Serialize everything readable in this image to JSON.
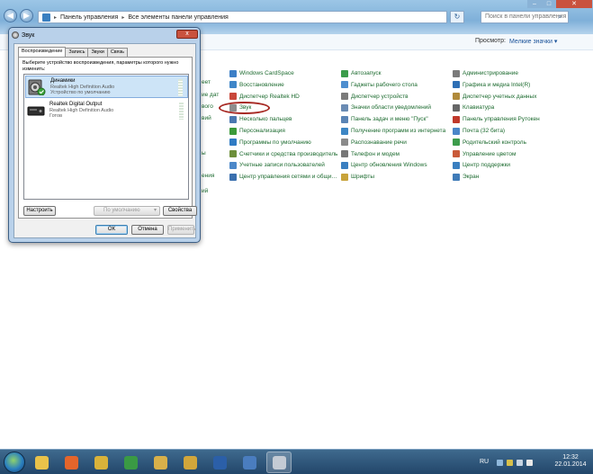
{
  "explorer": {
    "address": [
      "Панель управления",
      "Все элементы панели управления"
    ],
    "search_placeholder": "Поиск в панели управления",
    "view_label": "Просмотр:",
    "view_value": "Мелкие значки ▾"
  },
  "cp_items": {
    "col1": [
      {
        "label": "Windows CardSpace",
        "color": "#3d7fc6"
      },
      {
        "label": "Восстановление",
        "color": "#3f86c8"
      },
      {
        "label": "Диспетчер Realtek HD",
        "color": "#c9473a"
      },
      {
        "label": "Звук",
        "color": "#8d8d8d"
      },
      {
        "label": "Несколько пальцев",
        "color": "#4a78b0"
      },
      {
        "label": "Персонализация",
        "color": "#3b9a3a"
      },
      {
        "label": "Программы по умолчанию",
        "color": "#2f7bc3"
      },
      {
        "label": "Счетчики и средства производительн…",
        "color": "#6d8f3b"
      },
      {
        "label": "Учетные записи пользователей",
        "color": "#4c88c9"
      },
      {
        "label": "Центр управления сетями и общи…",
        "color": "#3a6fae"
      }
    ],
    "col2": [
      {
        "label": "Автозапуск",
        "color": "#3c9c4b"
      },
      {
        "label": "Гаджеты рабочего стола",
        "color": "#4e8ecf"
      },
      {
        "label": "Диспетчер устройств",
        "color": "#7a7a7a"
      },
      {
        "label": "Значки области уведомлений",
        "color": "#6a8bb3"
      },
      {
        "label": "Панель задач и меню \"Пуск\"",
        "color": "#5a84b5"
      },
      {
        "label": "Получение программ из интернета",
        "color": "#3d86c4"
      },
      {
        "label": "Распознавание речи",
        "color": "#8a8a8a"
      },
      {
        "label": "Телефон и модем",
        "color": "#777777"
      },
      {
        "label": "Центр обновления Windows",
        "color": "#3a7fc0"
      },
      {
        "label": "Шрифты",
        "color": "#c8a33a"
      }
    ],
    "col3": [
      {
        "label": "Администрирование",
        "color": "#7a7a7a"
      },
      {
        "label": "Графика и медиа Intel(R)",
        "color": "#2e6fb5"
      },
      {
        "label": "Диспетчер учетных данных",
        "color": "#b08a3a"
      },
      {
        "label": "Клавиатура",
        "color": "#666666"
      },
      {
        "label": "Панель управления Рутокен",
        "color": "#c0392b"
      },
      {
        "label": "Почта (32 бита)",
        "color": "#4a86c8"
      },
      {
        "label": "Родительский контроль",
        "color": "#3c9c4b"
      },
      {
        "label": "Управление цветом",
        "color": "#c95a3a"
      },
      {
        "label": "Центр поддержки",
        "color": "#3a7fc0"
      },
      {
        "label": "Экран",
        "color": "#3f7bb8"
      }
    ],
    "clipped": [
      "еет",
      "ие дат",
      "вого",
      "вий",
      "ы",
      "ения",
      "ий"
    ]
  },
  "dialog": {
    "title": "Звук",
    "close": "x",
    "tabs": [
      "Воспроизведение",
      "Запись",
      "Звуки",
      "Связь"
    ],
    "description": "Выберите устройство воспроизведения, параметры которого нужно изменить:",
    "devices": [
      {
        "name": "Динамики",
        "line1": "Realtek High Definition Audio",
        "line2": "Устройство по умолчанию",
        "icon": "speaker-icon"
      },
      {
        "name": "Realtek Digital Output",
        "line1": "Realtek High Definition Audio",
        "line2": "Готов",
        "icon": "digital-output-icon"
      }
    ],
    "configure_btn": "Настроить",
    "default_btn": "По умолчанию",
    "properties_btn": "Свойства",
    "ok_btn": "ОК",
    "cancel_btn": "Отмена",
    "apply_btn": "Применить"
  },
  "taskbar": {
    "lang": "RU",
    "time": "12:32",
    "date": "22.01.2014",
    "apps": [
      "explorer-icon",
      "firefox-icon",
      "folder-icon",
      "chrome-icon",
      "files-icon",
      "documents-icon",
      "word-icon",
      "remote-icon",
      "sound-settings-icon"
    ]
  }
}
